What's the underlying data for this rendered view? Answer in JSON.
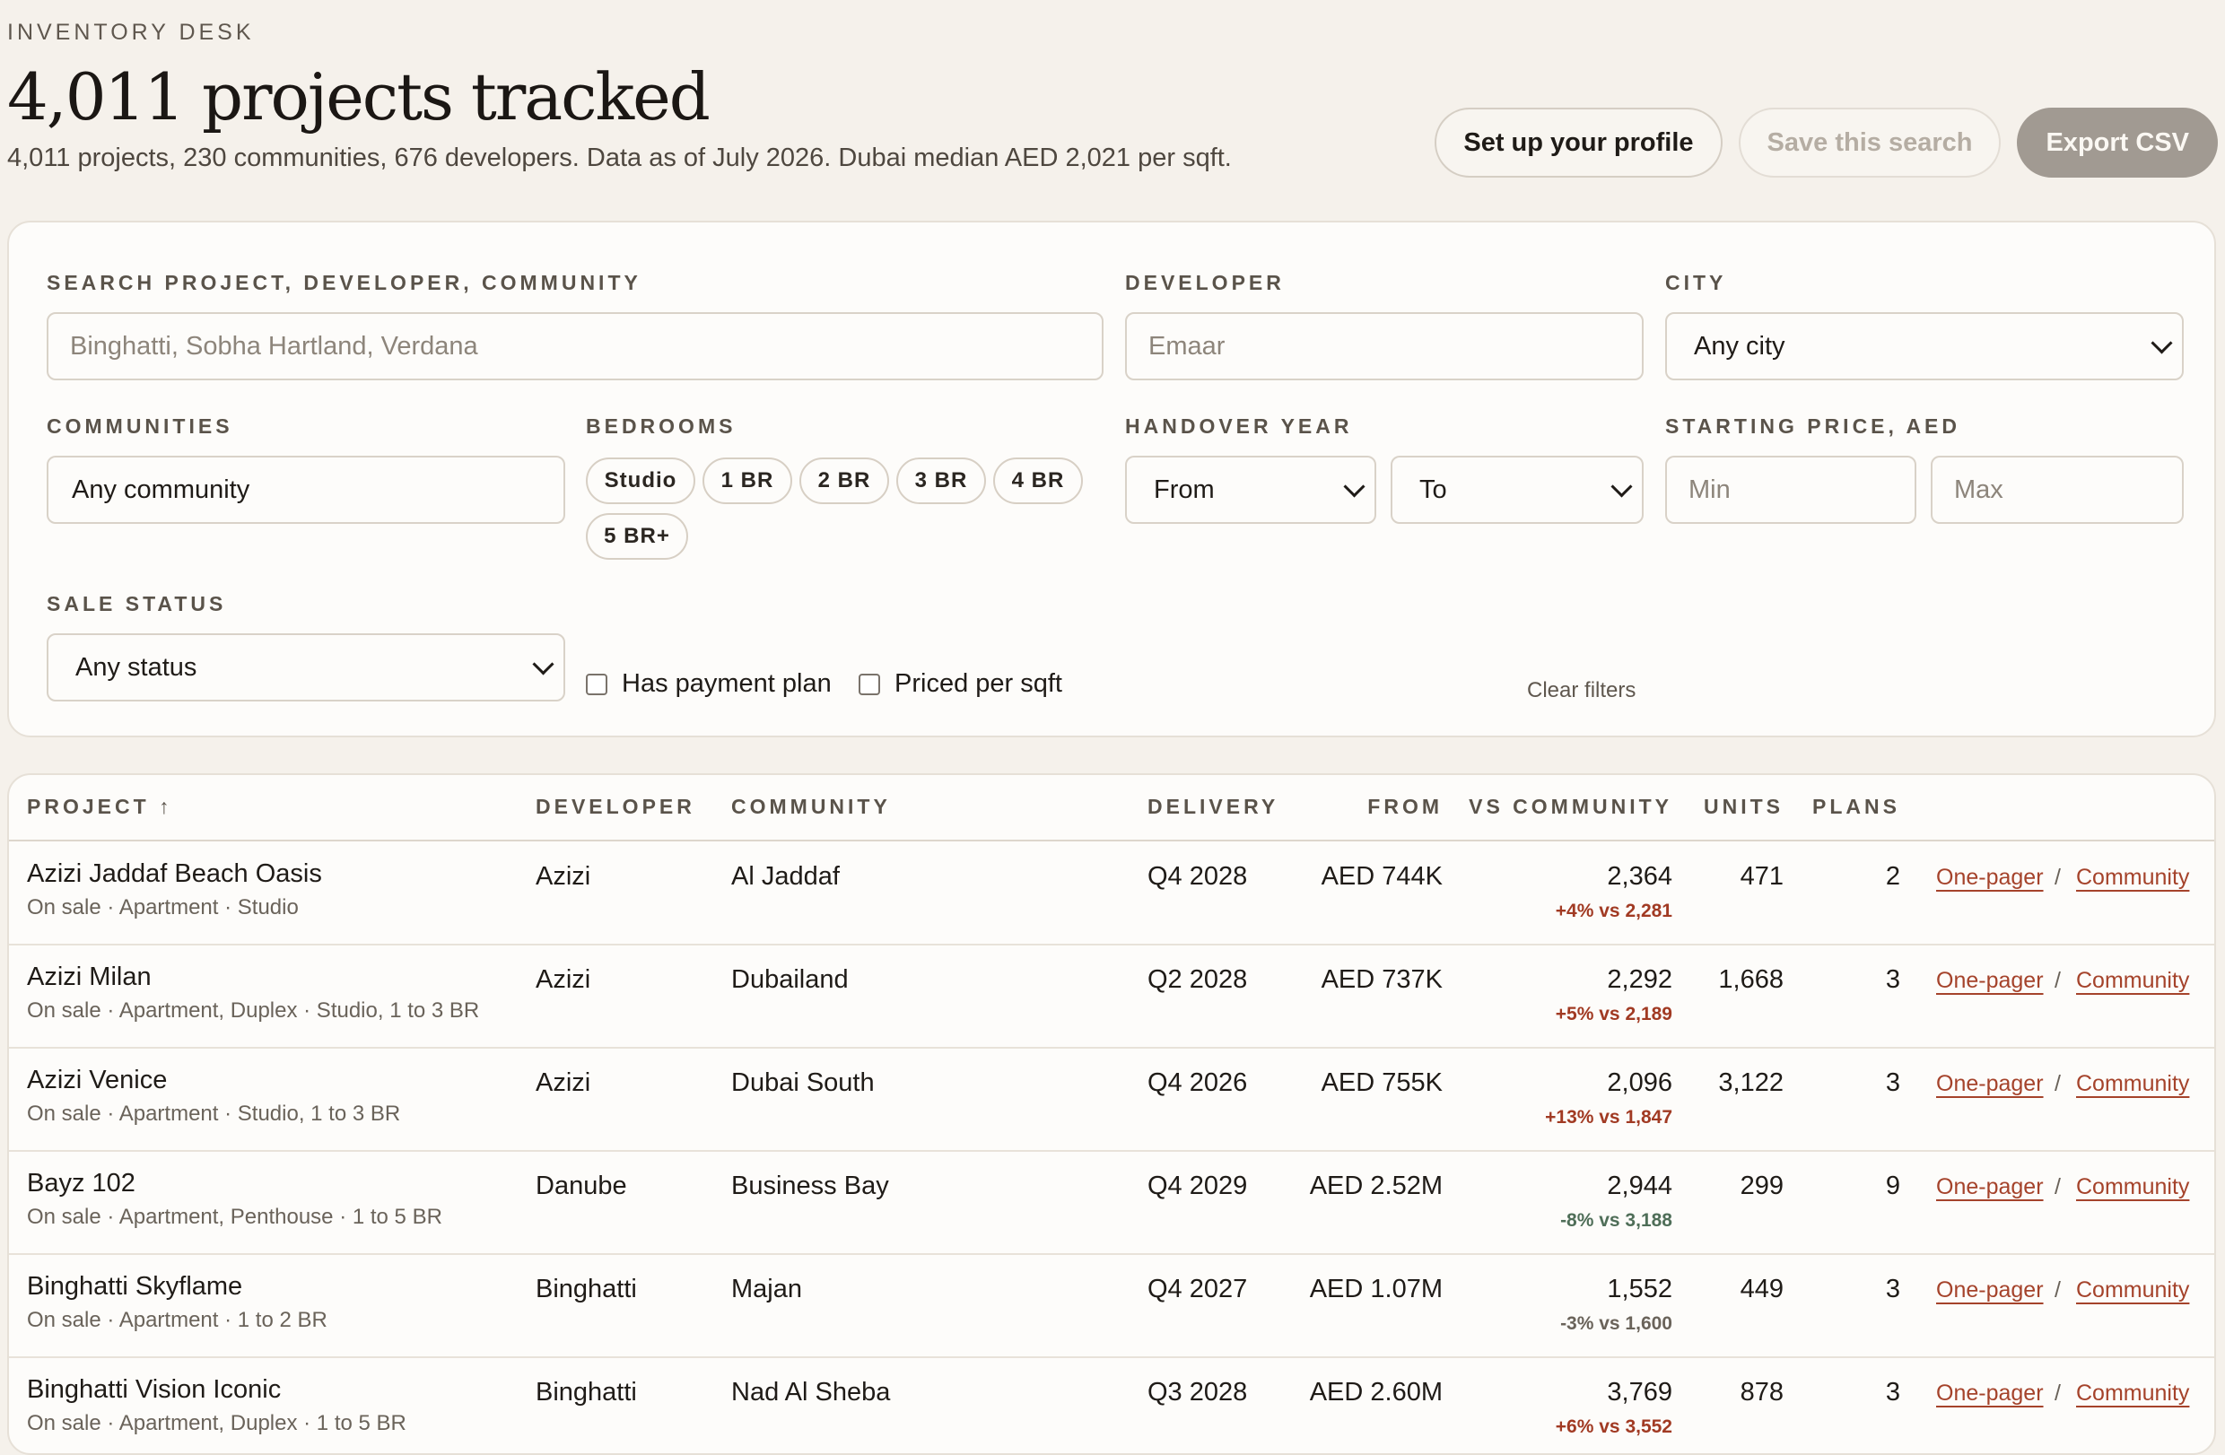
{
  "header": {
    "eyebrow": "INVENTORY DESK",
    "title": "4,011 projects tracked",
    "summary": "4,011 projects, 230 communities, 676 developers. Data as of July 2026. Dubai median AED 2,021 per sqft."
  },
  "actions": {
    "profile": "Set up your profile",
    "save_search": "Save this search",
    "export": "Export CSV"
  },
  "filters": {
    "search_label": "SEARCH PROJECT, DEVELOPER, COMMUNITY",
    "search_placeholder": "Binghatti, Sobha Hartland, Verdana",
    "developer_label": "DEVELOPER",
    "developer_placeholder": "Emaar",
    "city_label": "CITY",
    "city_value": "Any city",
    "communities_label": "COMMUNITIES",
    "communities_value": "Any community",
    "bedrooms_label": "BEDROOMS",
    "bedrooms": [
      "Studio",
      "1 BR",
      "2 BR",
      "3 BR",
      "4 BR",
      "5 BR+"
    ],
    "handover_label": "HANDOVER YEAR",
    "handover_from": "From",
    "handover_to": "To",
    "price_label": "STARTING PRICE, AED",
    "price_min_placeholder": "Min",
    "price_max_placeholder": "Max",
    "sale_status_label": "SALE STATUS",
    "sale_status_value": "Any status",
    "payment_plan_label": "Has payment plan",
    "priced_sqft_label": "Priced per sqft",
    "clear_label": "Clear filters"
  },
  "table": {
    "columns": {
      "project": "PROJECT ↑",
      "developer": "DEVELOPER",
      "community": "COMMUNITY",
      "delivery": "DELIVERY",
      "from": "FROM",
      "vs_community": "VS COMMUNITY",
      "units": "UNITS",
      "plans": "PLANS"
    },
    "link_onepager": "One-pager",
    "link_separator": "/",
    "link_community": "Community",
    "rows": [
      {
        "name": "Azizi Jaddaf Beach Oasis",
        "meta": "On sale · Apartment · Studio",
        "developer": "Azizi",
        "community": "Al Jaddaf",
        "delivery": "Q4 2028",
        "from": "AED 744K",
        "psf": "2,364",
        "delta": "+4% vs 2,281",
        "delta_dir": "up",
        "units": "471",
        "plans": "2"
      },
      {
        "name": "Azizi Milan",
        "meta": "On sale · Apartment, Duplex · Studio, 1 to 3 BR",
        "developer": "Azizi",
        "community": "Dubailand",
        "delivery": "Q2 2028",
        "from": "AED 737K",
        "psf": "2,292",
        "delta": "+5% vs 2,189",
        "delta_dir": "up",
        "units": "1,668",
        "plans": "3"
      },
      {
        "name": "Azizi Venice",
        "meta": "On sale · Apartment · Studio, 1 to 3 BR",
        "developer": "Azizi",
        "community": "Dubai South",
        "delivery": "Q4 2026",
        "from": "AED 755K",
        "psf": "2,096",
        "delta": "+13% vs 1,847",
        "delta_dir": "up",
        "units": "3,122",
        "plans": "3"
      },
      {
        "name": "Bayz 102",
        "meta": "On sale · Apartment, Penthouse · 1 to 5 BR",
        "developer": "Danube",
        "community": "Business Bay",
        "delivery": "Q4 2029",
        "from": "AED 2.52M",
        "psf": "2,944",
        "delta": "-8% vs 3,188",
        "delta_dir": "down",
        "units": "299",
        "plans": "9"
      },
      {
        "name": "Binghatti Skyflame",
        "meta": "On sale · Apartment · 1 to 2 BR",
        "developer": "Binghatti",
        "community": "Majan",
        "delivery": "Q4 2027",
        "from": "AED 1.07M",
        "psf": "1,552",
        "delta": "-3% vs 1,600",
        "delta_dir": "neutral",
        "units": "449",
        "plans": "3"
      },
      {
        "name": "Binghatti Vision Iconic",
        "meta": "On sale · Apartment, Duplex · 1 to 5 BR",
        "developer": "Binghatti",
        "community": "Nad Al Sheba",
        "delivery": "Q3 2028",
        "from": "AED 2.60M",
        "psf": "3,769",
        "delta": "+6% vs 3,552",
        "delta_dir": "up",
        "units": "878",
        "plans": "3"
      }
    ]
  }
}
